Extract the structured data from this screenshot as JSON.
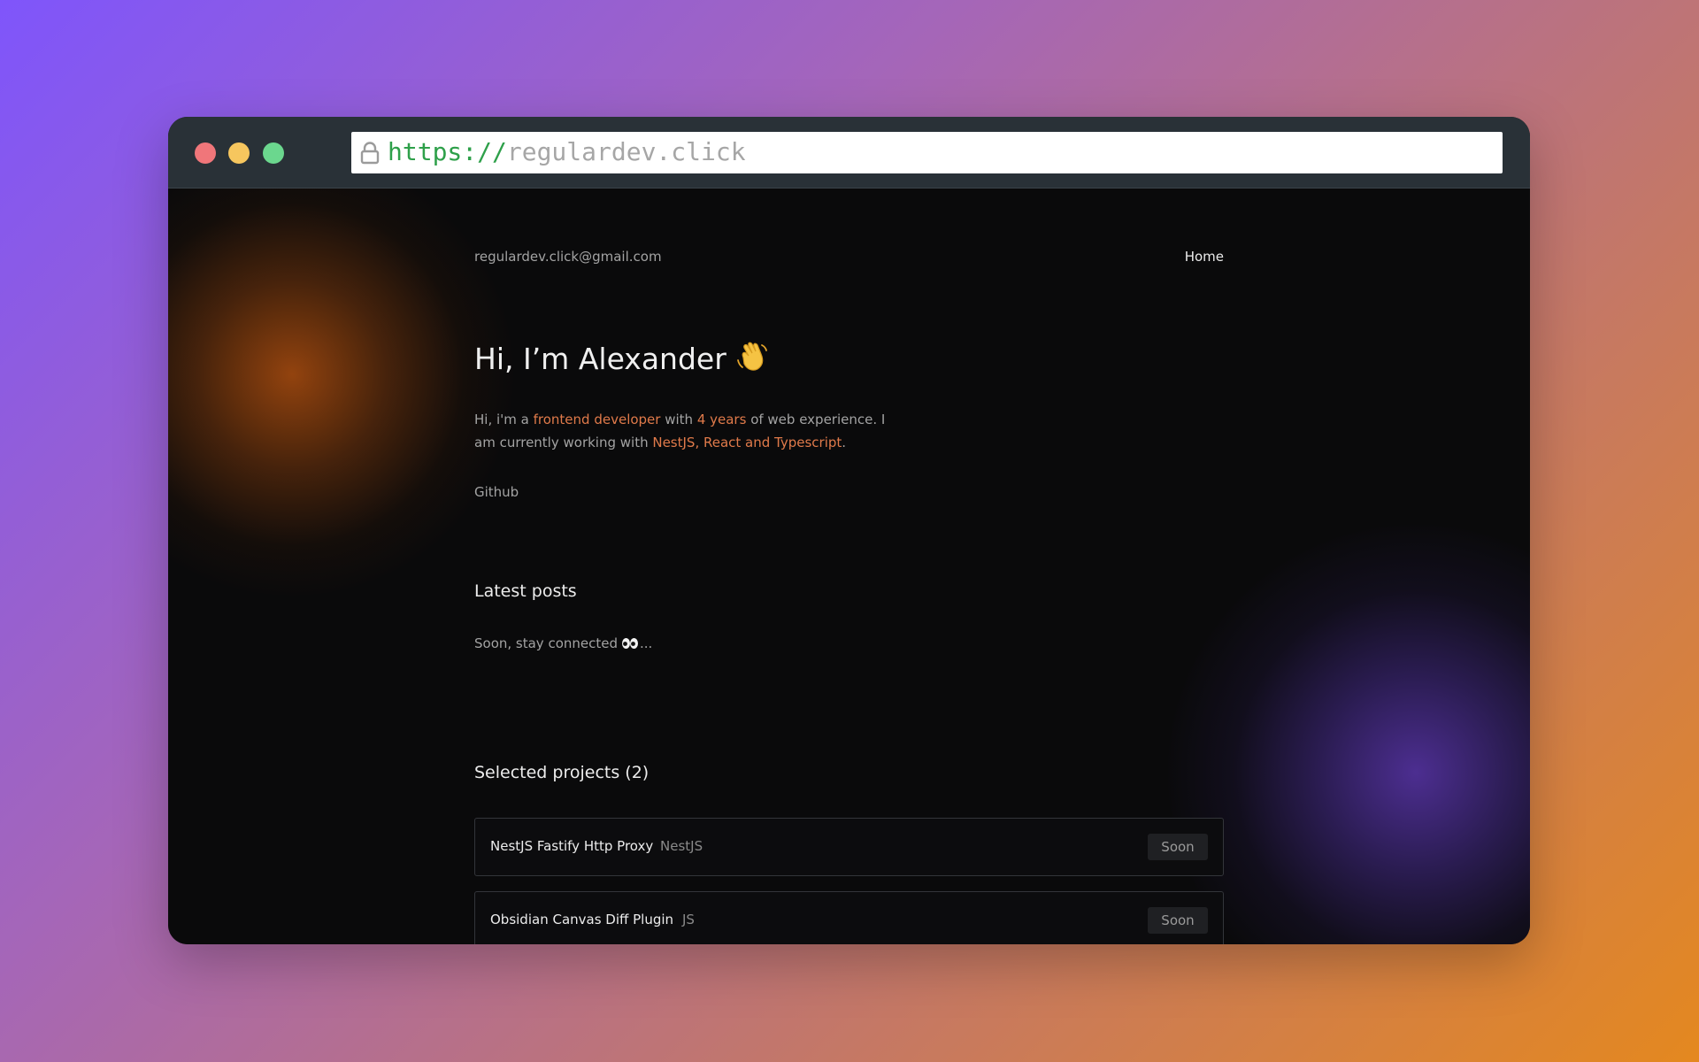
{
  "browser": {
    "url_scheme": "https://",
    "url_host": "regulardev.click",
    "window_controls": [
      "close",
      "minimize",
      "maximize"
    ]
  },
  "header": {
    "email": "regulardev.click@gmail.com",
    "nav_home": "Home"
  },
  "hero": {
    "title": "Hi, I’m Alexander",
    "emoji": "waving-hand-icon"
  },
  "intro": {
    "part1": "Hi, i'm a ",
    "highlight1": "frontend developer",
    "part2": " with ",
    "highlight2": "4 years",
    "part3": " of web experience. I am currently working with ",
    "highlight3": "NestJS, React and Typescript",
    "part4": "."
  },
  "links": {
    "github": "Github"
  },
  "posts": {
    "title": "Latest posts",
    "empty_text_before": "Soon, stay connected",
    "empty_text_after": "..."
  },
  "projects": {
    "title": "Selected projects (2)",
    "items": [
      {
        "name": "NestJS Fastify Http Proxy",
        "tag": "NestJS",
        "status": "Soon"
      },
      {
        "name": "Obsidian Canvas Diff Plugin",
        "tag": "JS",
        "status": "Soon"
      }
    ]
  },
  "colors": {
    "background_gradient": [
      "#7f55fb",
      "#a566b8",
      "#c1766e",
      "#e4881f"
    ],
    "titlebar": "#293137",
    "page_background": "#0a0a0b",
    "accent": "#e07a4a",
    "traffic_red": "#f0767a",
    "traffic_yellow": "#f6c65e",
    "traffic_green": "#6bd78e",
    "url_scheme": "#2ea04a"
  }
}
